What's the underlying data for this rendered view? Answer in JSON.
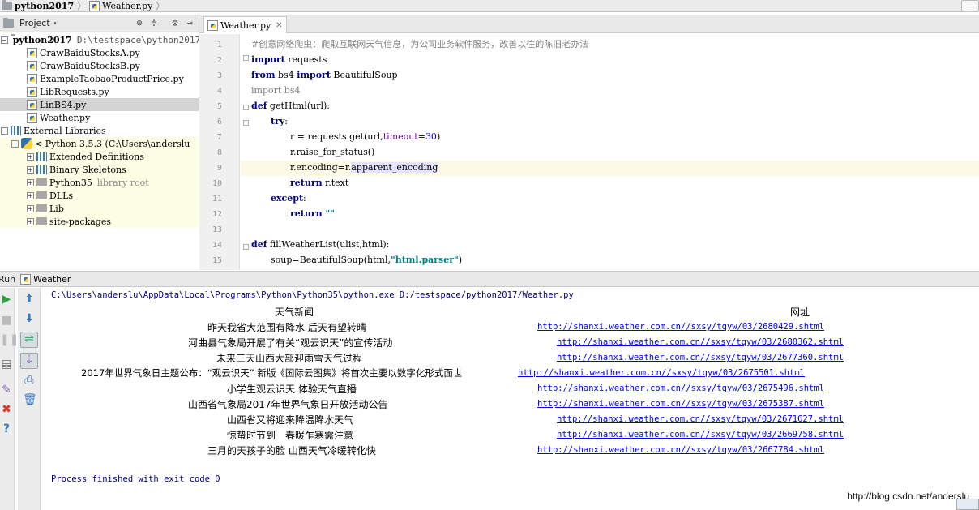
{
  "breadcrumb": {
    "project": "python2017",
    "file": "Weather.py"
  },
  "project_panel": {
    "title": "Project",
    "root": {
      "name": "python2017",
      "path": "D:\\testspace\\python2017"
    },
    "files": [
      "CrawBaiduStocksA.py",
      "CrawBaiduStocksB.py",
      "ExampleTaobaoProductPrice.py",
      "LibRequests.py",
      "LinBS4.py",
      "Weather.py"
    ],
    "external": "External Libraries",
    "python": "< Python 3.5.3 (C:\\Users\\anderslu",
    "libs": [
      {
        "name": "Extended Definitions",
        "extra": ""
      },
      {
        "name": "Binary Skeletons",
        "extra": ""
      },
      {
        "name": "Python35",
        "extra": "library root"
      },
      {
        "name": "DLLs",
        "extra": ""
      },
      {
        "name": "Lib",
        "extra": ""
      },
      {
        "name": "site-packages",
        "extra": ""
      }
    ]
  },
  "editor": {
    "tab": "Weather.py",
    "lines": [
      "1",
      "2",
      "3",
      "4",
      "5",
      "6",
      "7",
      "8",
      "9",
      "10",
      "11",
      "12",
      "13",
      "14",
      "15"
    ],
    "code": {
      "l1": "#创意网络爬虫：爬取互联网天气信息，为公司业务软件服务，改善以往的陈旧老办法",
      "import": "import",
      "from": "from",
      "requests": " requests",
      "bs4_mid": " bs4 ",
      "beautifulsoup": " BeautifulSoup",
      "bs4_end": " bs4",
      "def": "def",
      "gethtml": " getHtml(url):",
      "try": "try",
      "colon": ":",
      "l7a": "r = requests.get(url,",
      "timeout": "timeout",
      "eq": "=",
      "thirty": "30",
      "close_paren": ")",
      "l8": "r.raise_for_status()",
      "l9a": "r.encoding=r.",
      "l9b": "apparent_encoding",
      "return": "return",
      "rtext": " r.text",
      "except": "except",
      "empty_str": " \"\"",
      "fillweather": " fillWeatherList(ulist,html):",
      "l15a": "soup=BeautifulSoup(html,",
      "l15b": "\"html.parser\""
    }
  },
  "run_panel": {
    "run_label": "Run",
    "config": "Weather",
    "command": "C:\\Users\\anderslu\\AppData\\Local\\Programs\\Python\\Python35\\python.exe D:/testspace/python2017/Weather.py",
    "header_title": "天气新闻",
    "header_url": "网址",
    "news": [
      {
        "title": "昨天我省大范围有降水 后天有望转晴",
        "url": "http://shanxi.weather.com.cn//sxsy/tqyw/03/2680429.shtml"
      },
      {
        "title": "河曲县气象局开展了有关“观云识天”的宣传活动",
        "url": "http://shanxi.weather.com.cn//sxsy/tqyw/03/2680362.shtml"
      },
      {
        "title": "未来三天山西大部迎雨雪天气过程",
        "url": "http://shanxi.weather.com.cn//sxsy/tqyw/03/2677360.shtml"
      },
      {
        "title": "2017年世界气象日主题公布：“观云识天” 新版《国际云图集》将首次主要以数字化形式面世",
        "url": "http://shanxi.weather.com.cn//sxsy/tqyw/03/2675501.shtml"
      },
      {
        "title": "小学生观云识天 体验天气直播",
        "url": "http://shanxi.weather.com.cn//sxsy/tqyw/03/2675496.shtml"
      },
      {
        "title": "山西省气象局2017年世界气象日开放活动公告",
        "url": "http://shanxi.weather.com.cn//sxsy/tqyw/03/2675387.shtml"
      },
      {
        "title": "山西省又将迎来降温降水天气",
        "url": "http://shanxi.weather.com.cn//sxsy/tqyw/03/2671627.shtml"
      },
      {
        "title": "惊蛰时节到　春暖乍寒需注意",
        "url": "http://shanxi.weather.com.cn//sxsy/tqyw/03/2669758.shtml"
      },
      {
        "title": "三月的天孩子的脸 山西天气冷暖转化快",
        "url": "http://shanxi.weather.com.cn//sxsy/tqyw/03/2667784.shtml"
      }
    ],
    "footer": "Process finished with exit code 0",
    "watermark": "http://blog.csdn.net/anderslu"
  }
}
